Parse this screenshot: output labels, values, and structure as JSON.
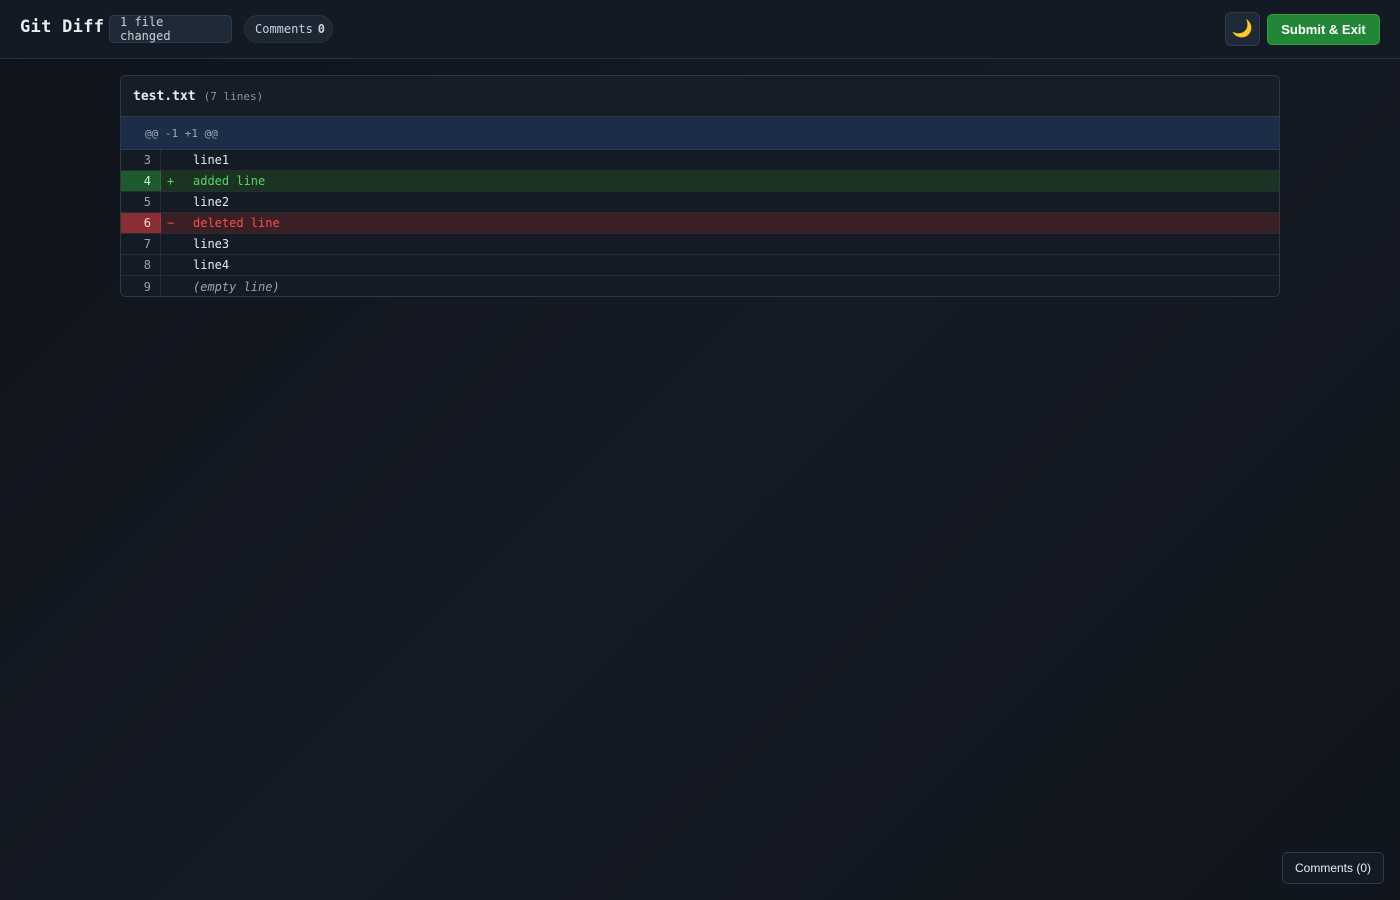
{
  "header": {
    "title": "Git Diff",
    "files_badge": "1 file changed",
    "comments_badge_label": "Comments",
    "comments_badge_count": "0",
    "theme_icon": "🌙",
    "submit_label": "Submit & Exit"
  },
  "file": {
    "name": "test.txt",
    "meta": "(7 lines)",
    "hunk": "@@ -1 +1 @@",
    "lines": [
      {
        "num": "3",
        "marker": "",
        "text": "line1",
        "type": "context"
      },
      {
        "num": "4",
        "marker": "+",
        "text": "added line",
        "type": "added"
      },
      {
        "num": "5",
        "marker": "",
        "text": "line2",
        "type": "context"
      },
      {
        "num": "6",
        "marker": "−",
        "text": "deleted line",
        "type": "deleted"
      },
      {
        "num": "7",
        "marker": "",
        "text": "line3",
        "type": "context"
      },
      {
        "num": "8",
        "marker": "",
        "text": "line4",
        "type": "context"
      },
      {
        "num": "9",
        "marker": "",
        "text": "(empty line)",
        "type": "empty"
      }
    ]
  },
  "comments_panel": {
    "label": "Comments (0)"
  },
  "colors": {
    "added": "#56d364",
    "deleted": "#f85149",
    "submit": "#238636",
    "hunk_bg": "#1c2e47"
  },
  "icons": {
    "theme_toggle": "moon-icon"
  }
}
